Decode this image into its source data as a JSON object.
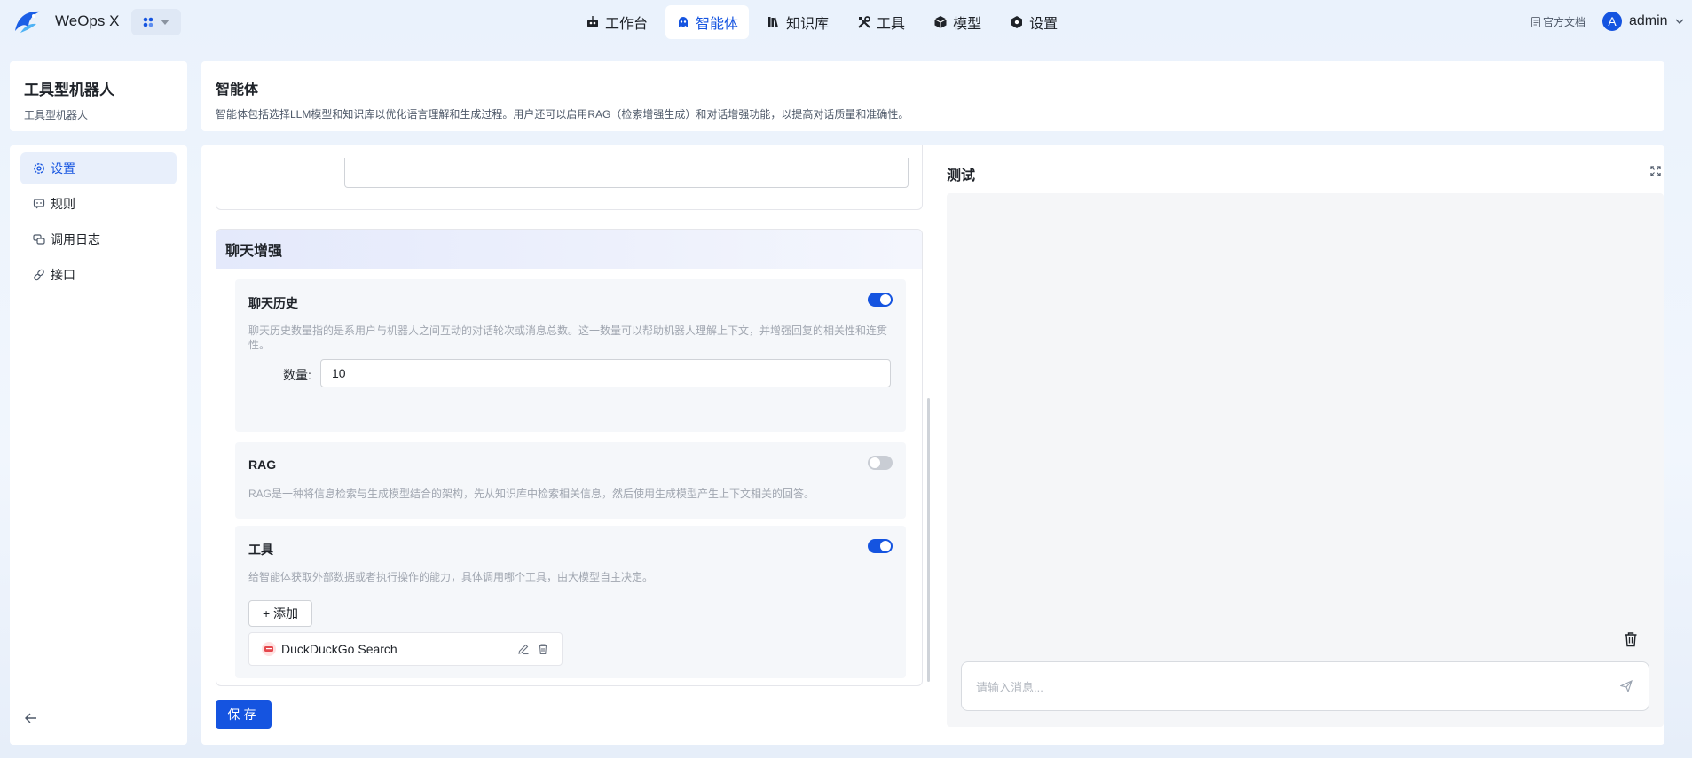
{
  "app": {
    "brand": "WeOps X"
  },
  "nav": {
    "items": [
      {
        "label": "工作台",
        "icon": "robot-icon"
      },
      {
        "label": "智能体",
        "icon": "bot-icon",
        "active": true
      },
      {
        "label": "知识库",
        "icon": "books-icon"
      },
      {
        "label": "工具",
        "icon": "tools-icon"
      },
      {
        "label": "模型",
        "icon": "cube-icon"
      },
      {
        "label": "设置",
        "icon": "gear-icon"
      }
    ],
    "docs": "官方文档",
    "user": "admin",
    "avatar_letter": "A"
  },
  "left": {
    "title": "工具型机器人",
    "subtitle": "工具型机器人",
    "menu": [
      {
        "label": "设置",
        "icon": "settings-icon",
        "active": true
      },
      {
        "label": "规则",
        "icon": "rules-icon"
      },
      {
        "label": "调用日志",
        "icon": "log-icon"
      },
      {
        "label": "接口",
        "icon": "link-icon"
      }
    ]
  },
  "header": {
    "title": "智能体",
    "description": "智能体包括选择LLM模型和知识库以优化语言理解和生成过程。用户还可以启用RAG（检索增强生成）和对话增强功能，以提高对话质量和准确性。"
  },
  "section": {
    "title": "聊天增强",
    "history": {
      "title": "聊天历史",
      "enabled": true,
      "description": "聊天历史数量指的是系用户与机器人之间互动的对话轮次或消息总数。这一数量可以帮助机器人理解上下文，并增强回复的相关性和连贯性。",
      "qty_label": "数量:",
      "qty_value": "10"
    },
    "rag": {
      "title": "RAG",
      "enabled": false,
      "description": "RAG是一种将信息检索与生成模型结合的架构，先从知识库中检索相关信息，然后使用生成模型产生上下文相关的回答。"
    },
    "tools": {
      "title": "工具",
      "enabled": true,
      "description": "给智能体获取外部数据或者执行操作的能力，具体调用哪个工具，由大模型自主决定。",
      "add_label": "+ 添加",
      "items": [
        {
          "name": "DuckDuckGo Search"
        }
      ]
    }
  },
  "save_label": "保存",
  "test": {
    "title": "测试",
    "placeholder": "请输入消息..."
  },
  "colors": {
    "primary": "#1554e0",
    "toggle_off": "#c9cdd4"
  }
}
